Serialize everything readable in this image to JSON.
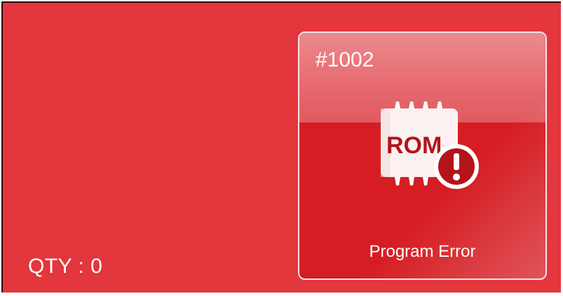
{
  "status": {
    "qty_label": "QTY : 0"
  },
  "error_tile": {
    "id": "#1002",
    "chip_text": "ROM",
    "icon": "rom-chip-error-icon",
    "caption": "Program Error"
  },
  "colors": {
    "background": "#e3363d",
    "tile": "#d51d23",
    "text": "#ffffff"
  }
}
